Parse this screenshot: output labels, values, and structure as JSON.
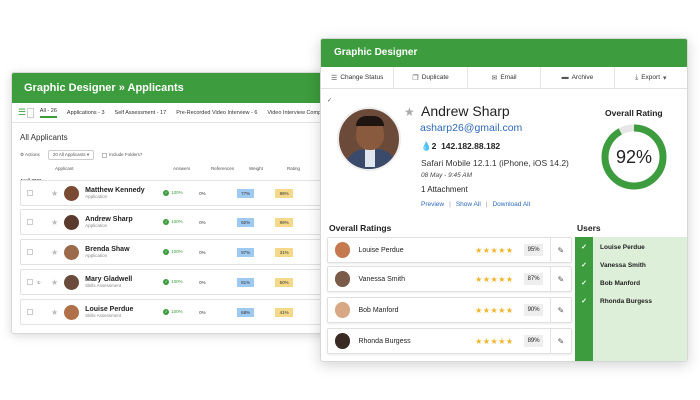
{
  "back_window": {
    "title": "Graphic Designer » Applicants",
    "tabs": [
      "All - 26",
      "Applications - 3",
      "Self Assessment - 17",
      "Pre-Recorded Video Interview - 6",
      "Video Interview Complete"
    ],
    "heading": "All Applicants",
    "tools": {
      "actions": "Actions",
      "filter": "20 All Applicants",
      "include_folders": "Include Folders?"
    },
    "columns": [
      "Applicant",
      "Answers",
      "References",
      "Weight",
      "Rating"
    ],
    "month": "April 2021",
    "rows": [
      {
        "name": "Matthew Kennedy",
        "stage": "Application",
        "answers": "100%",
        "references": "0%",
        "weight": "77%",
        "rating": "88%",
        "color": "#7a4a32"
      },
      {
        "name": "Andrew Sharp",
        "stage": "Application",
        "answers": "100%",
        "references": "0%",
        "weight": "92%",
        "rating": "99%",
        "color": "#5a3a2c"
      },
      {
        "name": "Brenda Shaw",
        "stage": "Application",
        "answers": "100%",
        "references": "0%",
        "weight": "97%",
        "rating": "31%",
        "color": "#9a6a4a"
      },
      {
        "name": "Mary Gladwell",
        "stage": "Skills Assessment",
        "answers": "100%",
        "references": "0%",
        "weight": "81%",
        "rating": "50%",
        "color": "#6a4a3a"
      },
      {
        "name": "Louise Perdue",
        "stage": "Skills Assessment",
        "answers": "100%",
        "references": "0%",
        "weight": "68%",
        "rating": "41%",
        "color": "#b0704a"
      }
    ]
  },
  "front_window": {
    "title": "Graphic Designer",
    "toolbar": {
      "change_status": "Change Status",
      "duplicate": "Duplicate",
      "email": "Email",
      "archive": "Archive",
      "export": "Export"
    },
    "profile": {
      "name": "Andrew Sharp",
      "email": "asharp26@gmail.com",
      "ip_count": "2",
      "ip": "142.182.88.182",
      "browser": "Safari Mobile 12.1.1 (iPhone, iOS 14.2)",
      "date": "08 May - 9:45 AM",
      "attachments": "1 Attachment",
      "links": {
        "preview": "Preview",
        "show_all": "Show All",
        "download_all": "Download All"
      }
    },
    "overall_rating": {
      "title": "Overall Rating",
      "value": "92%",
      "fraction": 0.92
    },
    "ratings_title": "Overall Ratings",
    "users_title": "Users",
    "ratings": [
      {
        "name": "Louise Perdue",
        "stars": "★★★★★",
        "pct": "95%",
        "color": "#c47a4e"
      },
      {
        "name": "Vanessa Smith",
        "stars": "★★★★★",
        "pct": "87%",
        "color": "#7a5a48"
      },
      {
        "name": "Bob Manford",
        "stars": "★★★★★",
        "pct": "90%",
        "color": "#d8a884"
      },
      {
        "name": "Rhonda Burgess",
        "stars": "★★★★★",
        "pct": "89%",
        "color": "#3a2a24"
      }
    ],
    "users": [
      "Louise Perdue",
      "Vanessa Smith",
      "Bob Manford",
      "Rhonda Burgess"
    ]
  },
  "colors": {
    "accent": "#3d9c3d",
    "link": "#2e6ab8",
    "star": "#f0b429"
  }
}
